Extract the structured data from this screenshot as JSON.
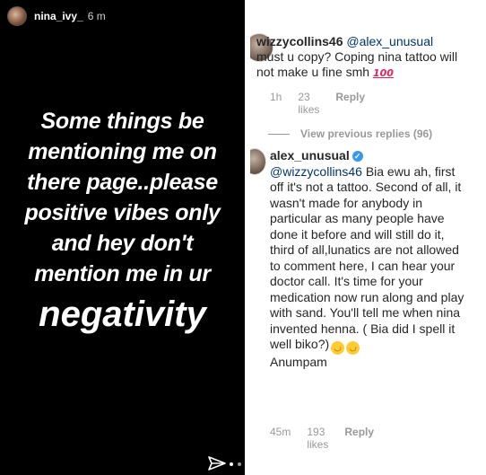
{
  "story": {
    "username": "nina_ivy_",
    "time": "6 m",
    "lines": [
      "Some things be",
      "mentioning me on",
      "there page..please",
      "positive vibes only",
      "and hey don't",
      "mention me in ur",
      "negativity"
    ]
  },
  "comments": {
    "first": {
      "username": "wizzycollins46",
      "mention": "@alex_unusual",
      "text": "must u copy? Coping nina tattoo will not make u fine smh",
      "emoji": "100",
      "time": "1h",
      "likes": "23 likes",
      "reply": "Reply"
    },
    "view_previous": "View previous replies (96)",
    "second": {
      "username": "alex_unusual",
      "mention": "@wizzycollins46",
      "text": "Bia ewu ah, first off it's not a tattoo. Second of all, it wasn't made for anybody in particular as many people have done it before and will still do it, third of all,lunatics are not allowed to comment here, I can hear your doctor call. It's time for your medication now run along and play with sand. You'll tell me when nina invented henna. ( Bia did I spell it well biko?)",
      "signoff": "Anumpam",
      "time": "45m",
      "likes": "193 likes",
      "reply": "Reply"
    }
  },
  "icons": {
    "send": "paper-plane-icon",
    "verified": "verified-badge-icon",
    "emoji_hundred": "hundred-points-emoji",
    "emoji_rofl": "rolling-on-floor-laughing-emoji"
  },
  "colors": {
    "story_bg": "#000000",
    "mention": "#003569",
    "meta": "#999999",
    "verified": "#3897f0"
  }
}
